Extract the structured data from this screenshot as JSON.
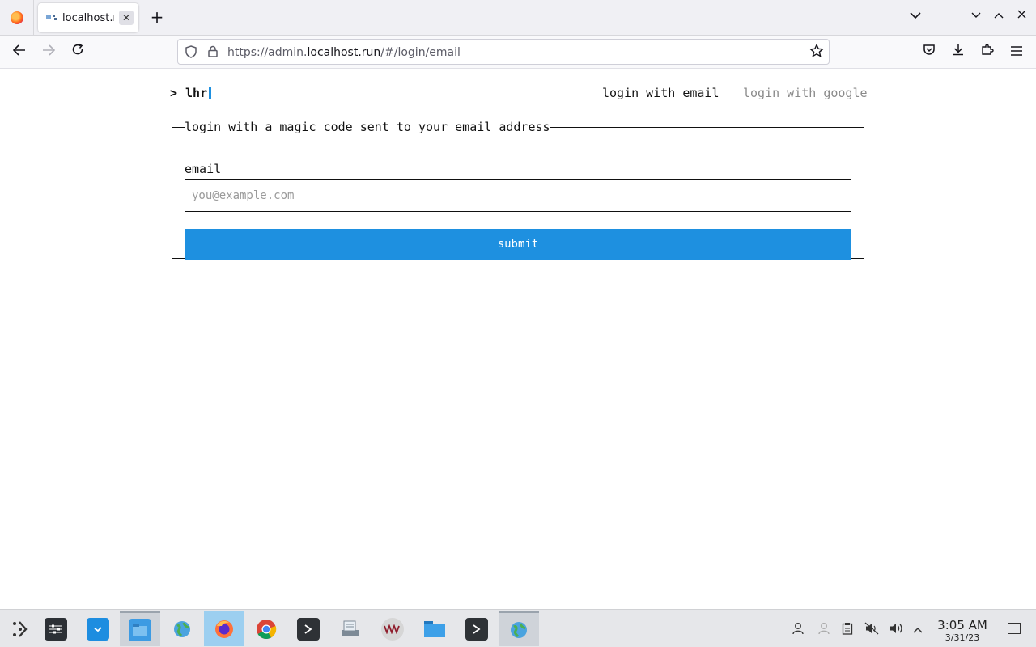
{
  "browser": {
    "tab": {
      "title": "localhost.r",
      "close_glyph": "✕"
    },
    "new_tab_glyph": "+",
    "url": {
      "prefix": "https://admin.",
      "host": "localhost.run",
      "path": "/#/login/email"
    }
  },
  "page": {
    "brand": {
      "caret": ">",
      "name": "lhr"
    },
    "nav": {
      "login_email": "login with email",
      "login_google": "login with google"
    },
    "form": {
      "legend": "login with a magic code sent to your email address",
      "email_label": "email",
      "email_value": "",
      "email_placeholder": "you@example.com",
      "submit_label": "submit"
    },
    "accent_color": "#1e90e0"
  },
  "taskbar": {
    "apps": [
      "application-launcher-icon",
      "system-settings-icon",
      "discover-store-icon",
      "file-manager-icon",
      "network-globe-icon",
      "firefox-icon",
      "chrome-icon",
      "terminal-icon",
      "scanner-icon",
      "vmware-icon",
      "folder-icon",
      "terminal-icon",
      "network-globe-icon"
    ],
    "clock": {
      "time": "3:05 AM",
      "date": "3/31/23"
    }
  }
}
